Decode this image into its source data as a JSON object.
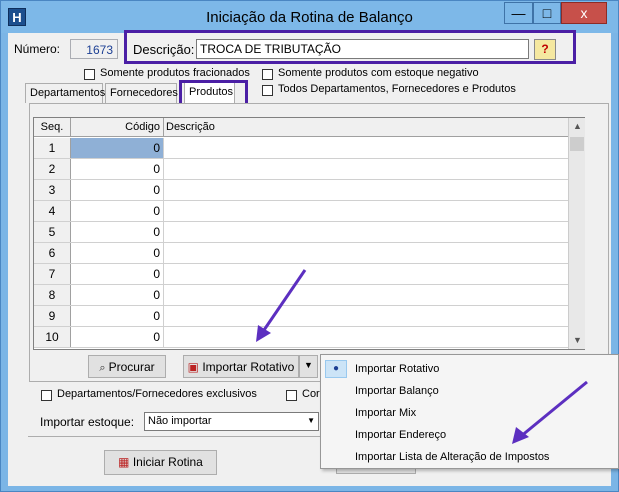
{
  "window": {
    "title": "Iniciação da Rotina de Balanço",
    "app_icon": "H",
    "minimize": "—",
    "maximize": "□",
    "close": "x"
  },
  "header": {
    "numero_label": "Número:",
    "numero_value": "1673",
    "descricao_label": "Descrição:",
    "descricao_value": "TROCA DE TRIBUTAÇÃO",
    "help": "?"
  },
  "options": {
    "fracionados": "Somente produtos fracionados",
    "estoque_negativo": "Somente produtos com estoque negativo",
    "todos": "Todos Departamentos, Fornecedores e Produtos"
  },
  "tabs": [
    "Departamentos",
    "Fornecedores",
    "Produtos"
  ],
  "grid": {
    "columns": [
      "Seq.",
      "Código",
      "Descrição"
    ],
    "rows": [
      {
        "seq": "1",
        "codigo": "0",
        "descricao": ""
      },
      {
        "seq": "2",
        "codigo": "0",
        "descricao": ""
      },
      {
        "seq": "3",
        "codigo": "0",
        "descricao": ""
      },
      {
        "seq": "4",
        "codigo": "0",
        "descricao": ""
      },
      {
        "seq": "5",
        "codigo": "0",
        "descricao": ""
      },
      {
        "seq": "6",
        "codigo": "0",
        "descricao": ""
      },
      {
        "seq": "7",
        "codigo": "0",
        "descricao": ""
      },
      {
        "seq": "8",
        "codigo": "0",
        "descricao": ""
      },
      {
        "seq": "9",
        "codigo": "0",
        "descricao": ""
      },
      {
        "seq": "10",
        "codigo": "0",
        "descricao": ""
      }
    ]
  },
  "buttons": {
    "procurar": "Procurar",
    "importar_rotativo": "Importar Rotativo",
    "iniciar_rotina": "Iniciar Rotina",
    "dropdown_arrow": "▼"
  },
  "bottom": {
    "exclusivos": "Departamentos/Fornecedores exclusivos",
    "partial_check_label": "Cor",
    "importar_estoque_label": "Importar estoque:",
    "importar_estoque_value": "Não importar"
  },
  "menu": {
    "items": [
      "Importar Rotativo",
      "Importar Balanço",
      "Importar Mix",
      "Importar Endereço",
      "Importar Lista de Alteração de Impostos"
    ],
    "selected_index": 0
  },
  "colors": {
    "highlight": "#4b1fa5",
    "arrow": "#5c2fc0",
    "selected_cell": "#8fb0d6"
  }
}
